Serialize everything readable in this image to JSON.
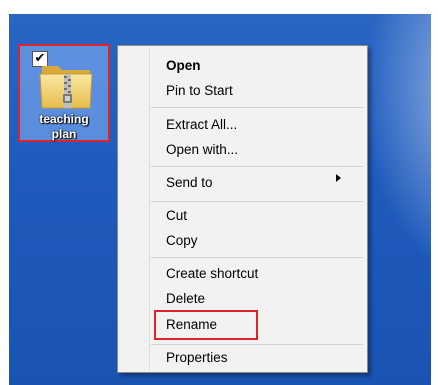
{
  "desktop": {
    "icon": {
      "label_line1": "teaching",
      "label_line2": "plan",
      "icon_name": "zip-folder-icon",
      "selected_check": "✔"
    }
  },
  "menu": {
    "items": [
      {
        "label": "Open"
      },
      {
        "label": "Pin to Start"
      },
      {
        "label": "Extract All..."
      },
      {
        "label": "Open with..."
      },
      {
        "label": "Send to"
      },
      {
        "label": "Cut"
      },
      {
        "label": "Copy"
      },
      {
        "label": "Create shortcut"
      },
      {
        "label": "Delete"
      },
      {
        "label": "Rename"
      },
      {
        "label": "Properties"
      }
    ],
    "highlight_color": "#e0232a"
  }
}
